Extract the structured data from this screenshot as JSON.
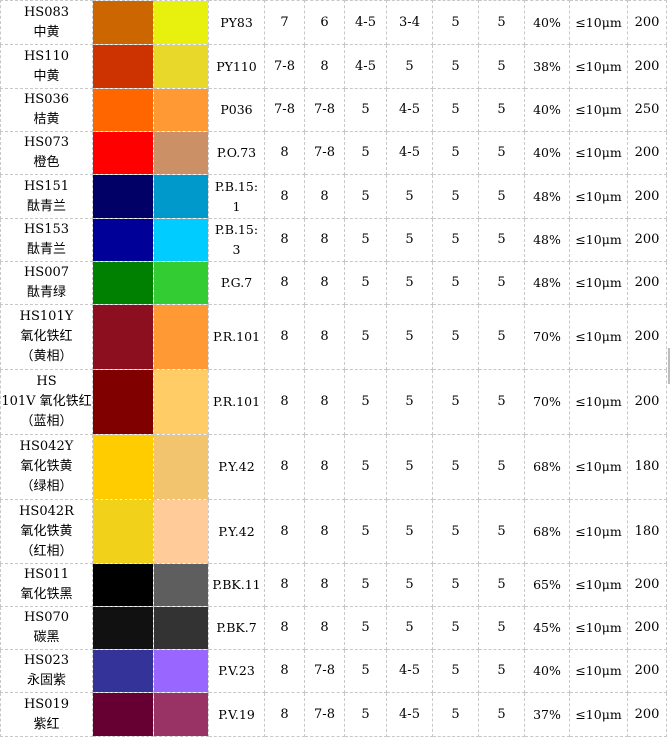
{
  "rows": [
    {
      "code": "HS083\n中黄",
      "c1": "#CC6600",
      "c2": "#E8F00E",
      "pigment": "PY83",
      "v1": "7",
      "v2": "6",
      "v3": "4-5",
      "v4": "3-4",
      "v5": "5",
      "v6": "5",
      "pct": "40%",
      "size": "≤10μm",
      "last": "200"
    },
    {
      "code": "HS110\n中黄",
      "c1": "#CC3300",
      "c2": "#E8D82A",
      "pigment": "PY110",
      "v1": "7-8",
      "v2": "8",
      "v3": "4-5",
      "v4": "5",
      "v5": "5",
      "v6": "5",
      "pct": "38%",
      "size": "≤10μm",
      "last": "200"
    },
    {
      "code": "HS036\n桔黄",
      "c1": "#FF6600",
      "c2": "#FF9933",
      "pigment": "P036",
      "v1": "7-8",
      "v2": "7-8",
      "v3": "5",
      "v4": "4-5",
      "v5": "5",
      "v6": "5",
      "pct": "40%",
      "size": "≤10μm",
      "last": "250"
    },
    {
      "code": "HS073\n橙色",
      "c1": "#FF0000",
      "c2": "#CC9066",
      "pigment": "P.O.73",
      "v1": "8",
      "v2": "7-8",
      "v3": "5",
      "v4": "4-5",
      "v5": "5",
      "v6": "5",
      "pct": "40%",
      "size": "≤10μm",
      "last": "200"
    },
    {
      "code": "HS151\n酞青兰",
      "c1": "#000066",
      "c2": "#0099CC",
      "pigment": "P.B.15:\n1",
      "v1": "8",
      "v2": "8",
      "v3": "5",
      "v4": "5",
      "v5": "5",
      "v6": "5",
      "pct": "48%",
      "size": "≤10μm",
      "last": "200"
    },
    {
      "code": "HS153\n酞青兰",
      "c1": "#000099",
      "c2": "#00CCFF",
      "pigment": "P.B.15:\n3",
      "v1": "8",
      "v2": "8",
      "v3": "5",
      "v4": "5",
      "v5": "5",
      "v6": "5",
      "pct": "48%",
      "size": "≤10μm",
      "last": "200"
    },
    {
      "code": "HS007\n酞青绿",
      "c1": "#008000",
      "c2": "#33CC33",
      "pigment": "P.G.7",
      "v1": "8",
      "v2": "8",
      "v3": "5",
      "v4": "5",
      "v5": "5",
      "v6": "5",
      "pct": "48%",
      "size": "≤10μm",
      "last": "200"
    },
    {
      "code": "HS101Y\n氧化铁红\n（黄相）",
      "c1": "#8B0F1F",
      "c2": "#FF9933",
      "pigment": "P.R.101",
      "v1": "8",
      "v2": "8",
      "v3": "5",
      "v4": "5",
      "v5": "5",
      "v6": "5",
      "pct": "70%",
      "size": "≤10μm",
      "last": "200"
    },
    {
      "code": "HS\n101V 氧化铁红\n（蓝相）",
      "c1": "#800000",
      "c2": "#FFCC66",
      "pigment": "P.R.101",
      "v1": "8",
      "v2": "8",
      "v3": "5",
      "v4": "5",
      "v5": "5",
      "v6": "5",
      "pct": "70%",
      "size": "≤10μm",
      "last": "200"
    },
    {
      "code": "HS042Y\n氧化铁黄\n（绿相）",
      "c1": "#FFCC00",
      "c2": "#F2C46E",
      "pigment": "P.Y.42",
      "v1": "8",
      "v2": "8",
      "v3": "5",
      "v4": "5",
      "v5": "5",
      "v6": "5",
      "pct": "68%",
      "size": "≤10μm",
      "last": "180"
    },
    {
      "code": "HS042R\n氧化铁黄\n（红相）",
      "c1": "#F2D11A",
      "c2": "#FFCC99",
      "pigment": "P.Y.42",
      "v1": "8",
      "v2": "8",
      "v3": "5",
      "v4": "5",
      "v5": "5",
      "v6": "5",
      "pct": "68%",
      "size": "≤10μm",
      "last": "180"
    },
    {
      "code": "HS011\n氧化铁黑",
      "c1": "#000000",
      "c2": "#5E5E5E",
      "pigment": "P.BK.11",
      "v1": "8",
      "v2": "8",
      "v3": "5",
      "v4": "5",
      "v5": "5",
      "v6": "5",
      "pct": "65%",
      "size": "≤10μm",
      "last": "200"
    },
    {
      "code": "HS070\n碳黑",
      "c1": "#111111",
      "c2": "#333333",
      "pigment": "P.BK.7",
      "v1": "8",
      "v2": "8",
      "v3": "5",
      "v4": "5",
      "v5": "5",
      "v6": "5",
      "pct": "45%",
      "size": "≤10μm",
      "last": "200"
    },
    {
      "code": "HS023\n永固紫",
      "c1": "#333399",
      "c2": "#9966FF",
      "pigment": "P.V.23",
      "v1": "8",
      "v2": "7-8",
      "v3": "5",
      "v4": "4-5",
      "v5": "5",
      "v6": "5",
      "pct": "40%",
      "size": "≤10μm",
      "last": "200"
    },
    {
      "code": "HS019\n紫红",
      "c1": "#660033",
      "c2": "#993366",
      "pigment": "P.V.19",
      "v1": "8",
      "v2": "7-8",
      "v3": "5",
      "v4": "4-5",
      "v5": "5",
      "v6": "5",
      "pct": "37%",
      "size": "≤10μm",
      "last": "200"
    }
  ]
}
